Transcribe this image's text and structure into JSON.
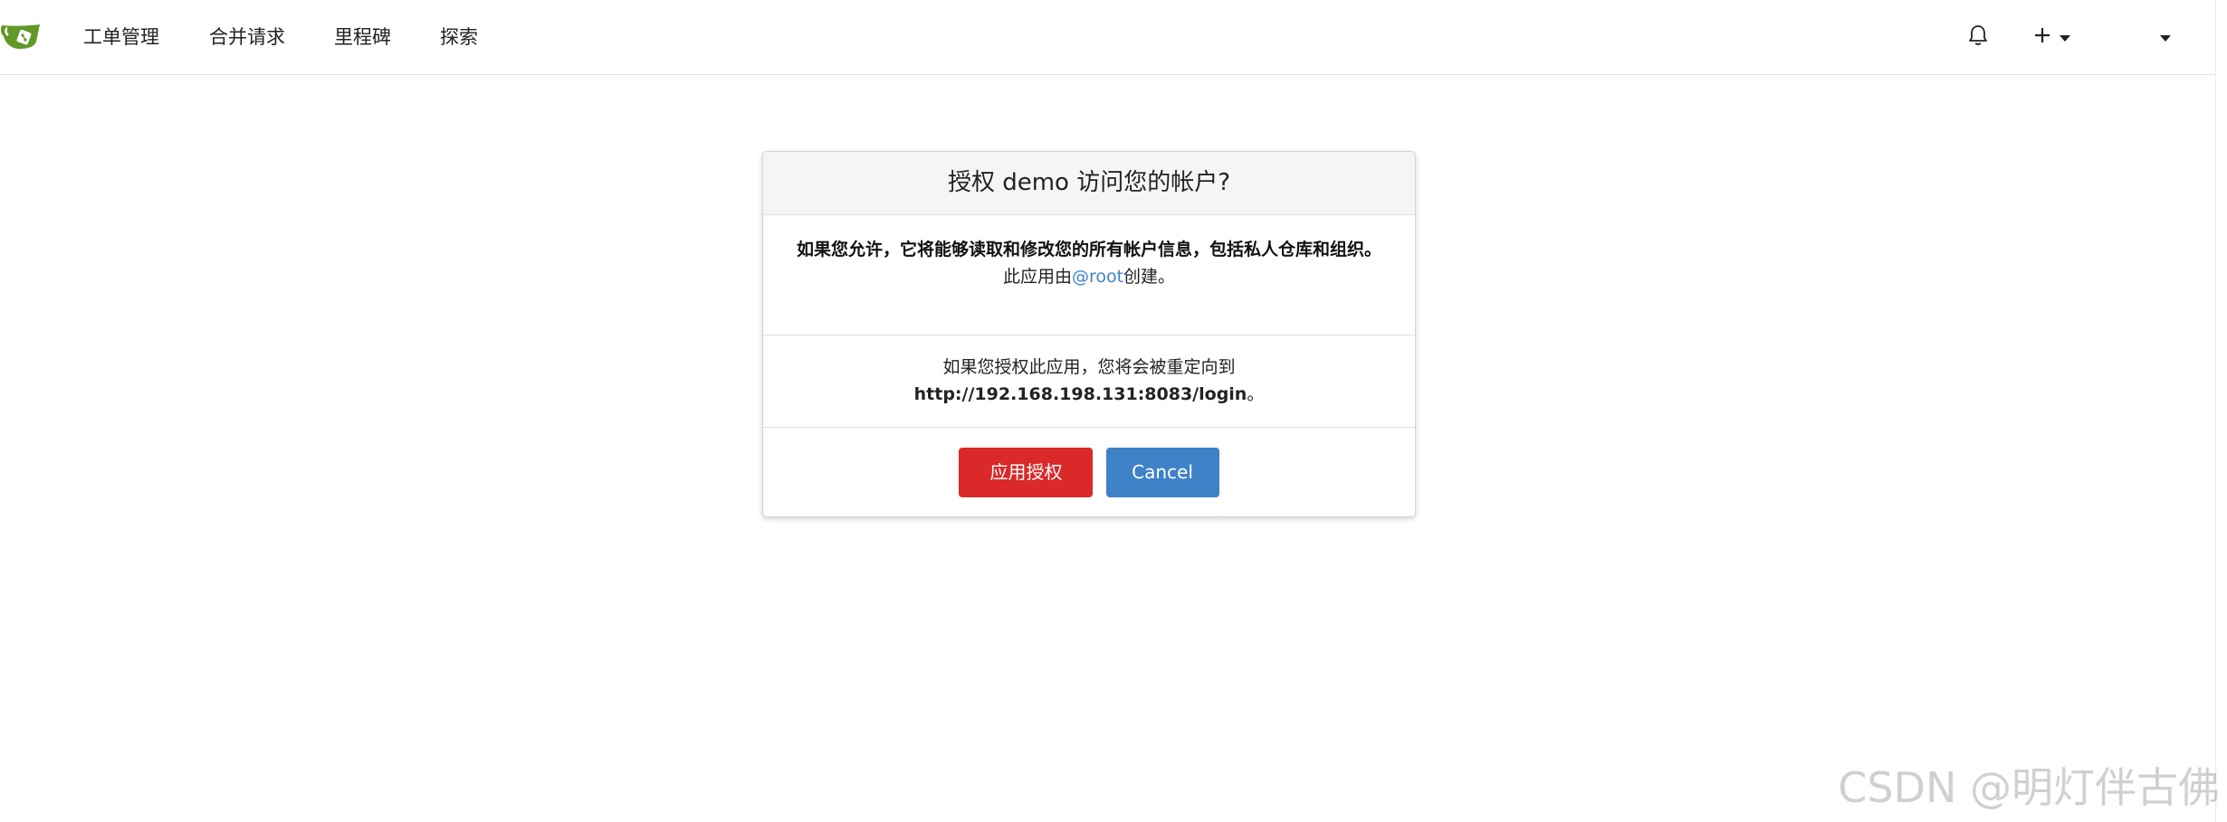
{
  "navbar": {
    "logo_icon": "gitea-logo-icon",
    "items": [
      {
        "label": "工单管理"
      },
      {
        "label": "合并请求"
      },
      {
        "label": "里程碑"
      },
      {
        "label": "探索"
      }
    ],
    "notifications_icon": "bell-icon",
    "create_icon": "plus-icon",
    "dropdown_icon": "caret-down-icon"
  },
  "modal": {
    "title": "授权 demo 访问您的帐户?",
    "permission_warning": "如果您允许，它将能够读取和修改您的所有帐户信息，包括私人仓库和组织。",
    "creator_prefix": "此应用由",
    "creator_link": "@root",
    "creator_suffix": "创建。",
    "redirect_text": "如果您授权此应用，您将会被重定向到",
    "redirect_url": "http://192.168.198.131:8083/login",
    "redirect_suffix": "。",
    "grant_button": "应用授权",
    "cancel_button": "Cancel"
  },
  "colors": {
    "grant": "#db2828",
    "cancel": "#3f82c7",
    "link": "#4183c4",
    "logo_green": "#609926"
  },
  "watermark": "CSDN @明灯伴古佛"
}
